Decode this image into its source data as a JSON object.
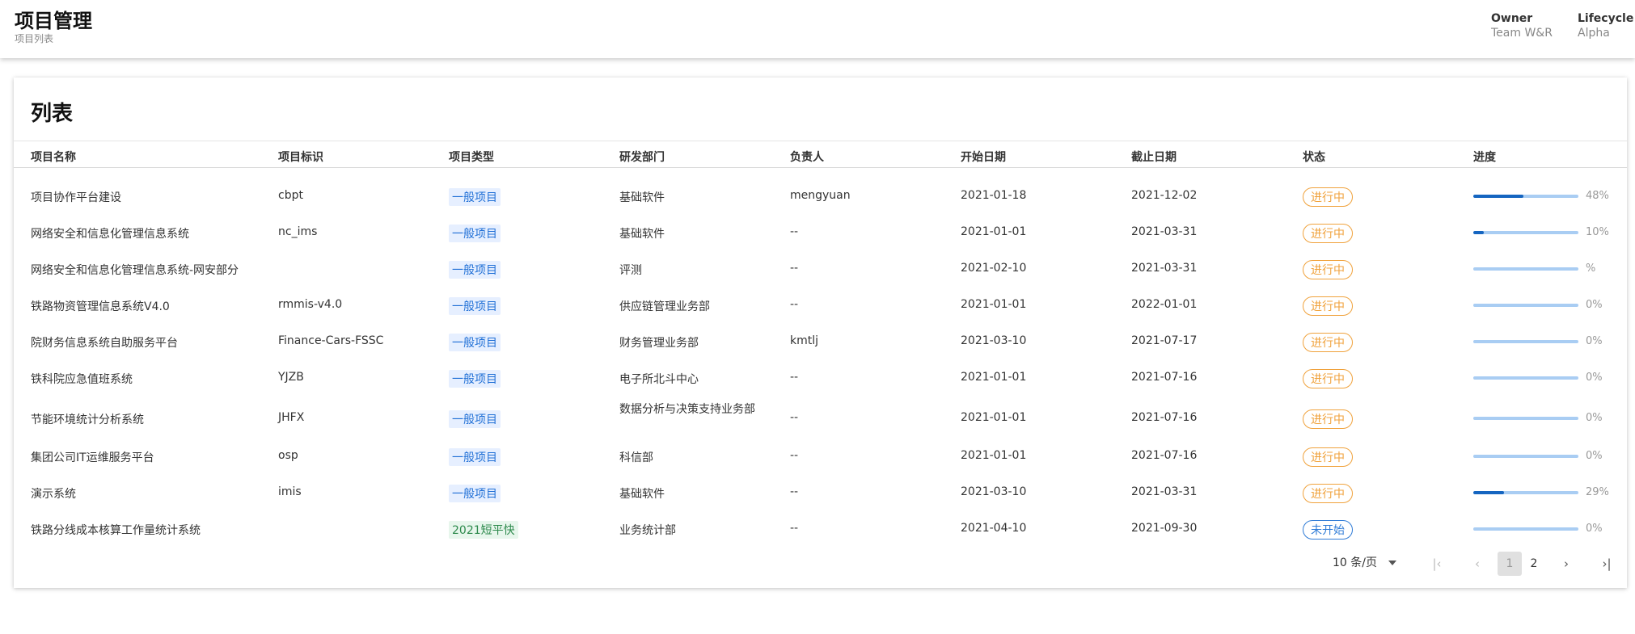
{
  "header": {
    "title": "项目管理",
    "subtitle": "项目列表",
    "owner_label": "Owner",
    "owner_value": "Team W&R",
    "lifecycle_label": "Lifecycle",
    "lifecycle_value": "Alpha"
  },
  "card": {
    "title": "列表"
  },
  "table": {
    "columns": [
      "项目名称",
      "项目标识",
      "项目类型",
      "研发部门",
      "负责人",
      "开始日期",
      "截止日期",
      "状态",
      "进度"
    ],
    "rows": [
      {
        "name": "项目协作平台建设",
        "code": "cbpt",
        "type": "一般项目",
        "dept": "基础软件",
        "owner": "mengyuan",
        "start": "2021-01-18",
        "end": "2021-12-02",
        "status": "进行中",
        "progress": 48,
        "progress_label": "48%"
      },
      {
        "name": "网络安全和信息化管理信息系统",
        "code": "nc_ims",
        "type": "一般项目",
        "dept": "基础软件",
        "owner": "--",
        "start": "2021-01-01",
        "end": "2021-03-31",
        "status": "进行中",
        "progress": 10,
        "progress_label": "10%"
      },
      {
        "name": "网络安全和信息化管理信息系统-网安部分",
        "code": "",
        "type": "一般项目",
        "dept": "评测",
        "owner": "--",
        "start": "2021-02-10",
        "end": "2021-03-31",
        "status": "进行中",
        "progress": 0,
        "progress_label": "%"
      },
      {
        "name": "铁路物资管理信息系统V4.0",
        "code": "rmmis-v4.0",
        "type": "一般项目",
        "dept": "供应链管理业务部",
        "owner": "--",
        "start": "2021-01-01",
        "end": "2022-01-01",
        "status": "进行中",
        "progress": 0,
        "progress_label": "0%"
      },
      {
        "name": "院财务信息系统自助服务平台",
        "code": "Finance-Cars-FSSC",
        "type": "一般项目",
        "dept": "财务管理业务部",
        "owner": "kmtlj",
        "start": "2021-03-10",
        "end": "2021-07-17",
        "status": "进行中",
        "progress": 0,
        "progress_label": "0%"
      },
      {
        "name": "铁科院应急值班系统",
        "code": "YJZB",
        "type": "一般项目",
        "dept": "电子所北斗中心",
        "owner": "--",
        "start": "2021-01-01",
        "end": "2021-07-16",
        "status": "进行中",
        "progress": 0,
        "progress_label": "0%"
      },
      {
        "name": "节能环境统计分析系统",
        "code": "JHFX",
        "type": "一般项目",
        "dept": "数据分析与决策支持业务部",
        "owner": "--",
        "start": "2021-01-01",
        "end": "2021-07-16",
        "status": "进行中",
        "progress": 0,
        "progress_label": "0%"
      },
      {
        "name": "集团公司IT运维服务平台",
        "code": "osp",
        "type": "一般项目",
        "dept": "科信部",
        "owner": "--",
        "start": "2021-01-01",
        "end": "2021-07-16",
        "status": "进行中",
        "progress": 0,
        "progress_label": "0%"
      },
      {
        "name": "演示系统",
        "code": "imis",
        "type": "一般项目",
        "dept": "基础软件",
        "owner": "--",
        "start": "2021-03-10",
        "end": "2021-03-31",
        "status": "进行中",
        "progress": 29,
        "progress_label": "29%"
      },
      {
        "name": "铁路分线成本核算工作量统计系统",
        "code": "",
        "type": "2021短平快",
        "dept": "业务统计部",
        "owner": "--",
        "start": "2021-04-10",
        "end": "2021-09-30",
        "status": "未开始",
        "progress": 0,
        "progress_label": "0%"
      }
    ]
  },
  "pagination": {
    "page_size_label": "10 条/页",
    "pages": [
      "1",
      "2"
    ],
    "current_page": "1"
  },
  "colors": {
    "accent": "#1565c0",
    "status_in_progress": "#f0a23c",
    "status_not_started": "#2f7bd6"
  },
  "icons": {
    "first_page": "first-page-icon",
    "prev_page": "chevron-left-icon",
    "next_page": "chevron-right-icon",
    "last_page": "last-page-icon",
    "dropdown": "caret-down-icon"
  }
}
